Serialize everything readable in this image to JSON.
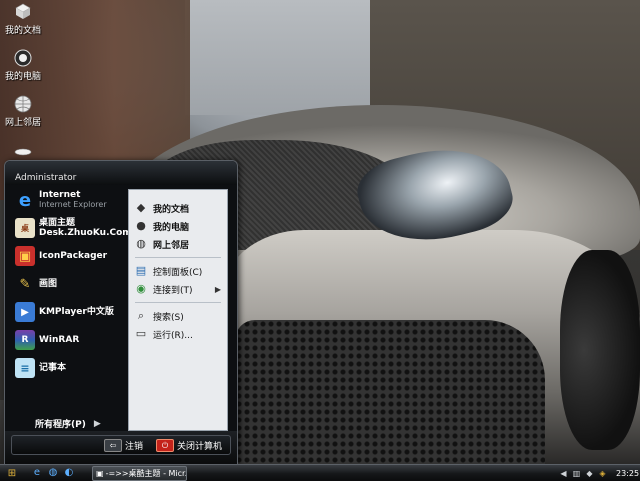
{
  "desktop": {
    "icons": [
      {
        "label": "我的文档",
        "icon": "my-documents-icon"
      },
      {
        "label": "我的电脑",
        "icon": "my-computer-icon"
      },
      {
        "label": "网上邻居",
        "icon": "network-places-icon"
      }
    ]
  },
  "start_menu": {
    "user": "Administrator",
    "pinned": [
      {
        "name": "Internet",
        "sub": "Internet Explorer",
        "icon": "internet-explorer-icon"
      },
      {
        "name": "桌面主题",
        "sub": "Desk.ZhuoKu.Com",
        "icon": "desktop-theme-icon"
      },
      {
        "name": "IconPackager",
        "sub": "",
        "icon": "iconpackager-icon"
      },
      {
        "name": "画图",
        "sub": "",
        "icon": "paint-icon"
      },
      {
        "name": "KMPlayer中文版",
        "sub": "",
        "icon": "kmplayer-icon"
      },
      {
        "name": "WinRAR",
        "sub": "",
        "icon": "winrar-icon"
      },
      {
        "name": "记事本",
        "sub": "",
        "icon": "notepad-icon"
      }
    ],
    "all_programs": "所有程序(P)",
    "places": [
      {
        "label": "我的文档",
        "icon": "my-documents-icon"
      },
      {
        "label": "我的电脑",
        "icon": "my-computer-icon"
      },
      {
        "label": "网上邻居",
        "icon": "network-places-icon"
      },
      {
        "label": "控制面板(C)",
        "icon": "control-panel-icon"
      },
      {
        "label": "连接到(T)",
        "icon": "connect-to-icon"
      },
      {
        "label": "搜索(S)",
        "icon": "search-icon"
      },
      {
        "label": "运行(R)...",
        "icon": "run-icon"
      }
    ],
    "logoff": "注销",
    "shutdown": "关闭计算机"
  },
  "taskbar": {
    "task_label": "-=>>桌酷主题 - Micr...",
    "clock": "23:25"
  },
  "colors": {
    "start_menu_bg": "#0d0f12",
    "places_bg": "#e9ebee",
    "logoff_accent": "#c25a18",
    "shutdown_accent": "#c4231b"
  }
}
